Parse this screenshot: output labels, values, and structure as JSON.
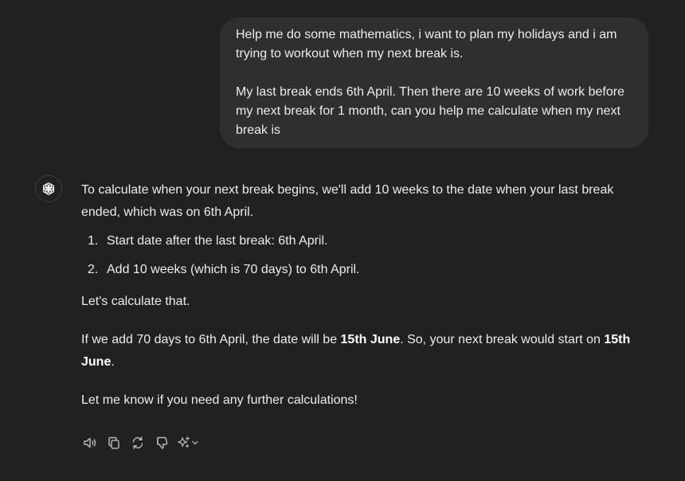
{
  "conversation": {
    "user_message": {
      "paragraph_1": "Help me do some mathematics, i want to plan my holidays and i am trying to workout when my next break is.",
      "paragraph_2": "My last break ends 6th April. Then there are 10 weeks of work before my next break for 1 month, can you help me calculate when my next break is"
    },
    "assistant_message": {
      "intro": "To calculate when your next break begins, we'll add 10 weeks to the date when your last break ended, which was on 6th April.",
      "steps": [
        {
          "number": "1.",
          "text": "Start date after the last break: 6th April."
        },
        {
          "number": "2.",
          "text": "Add 10 weeks (which is 70 days) to 6th April."
        }
      ],
      "calc_line": "Let's calculate that.",
      "result_part_1": "If we add 70 days to 6th April, the date will be ",
      "result_bold_1": "15th June",
      "result_part_2": ". So, your next break would start on ",
      "result_bold_2": "15th June",
      "result_part_3": ".",
      "closing": "Let me know if you need any further calculations!"
    },
    "actions": [
      {
        "name": "read-aloud",
        "icon": "speaker-icon"
      },
      {
        "name": "copy",
        "icon": "copy-icon"
      },
      {
        "name": "regenerate",
        "icon": "refresh-icon"
      },
      {
        "name": "bad-response",
        "icon": "thumbs-down-icon"
      },
      {
        "name": "switch-model",
        "icon": "sparkle-icon"
      }
    ]
  },
  "colors": {
    "background": "#212121",
    "user_bubble": "#2f2f2f",
    "text": "#ececec",
    "icon": "#b4b4b4"
  }
}
